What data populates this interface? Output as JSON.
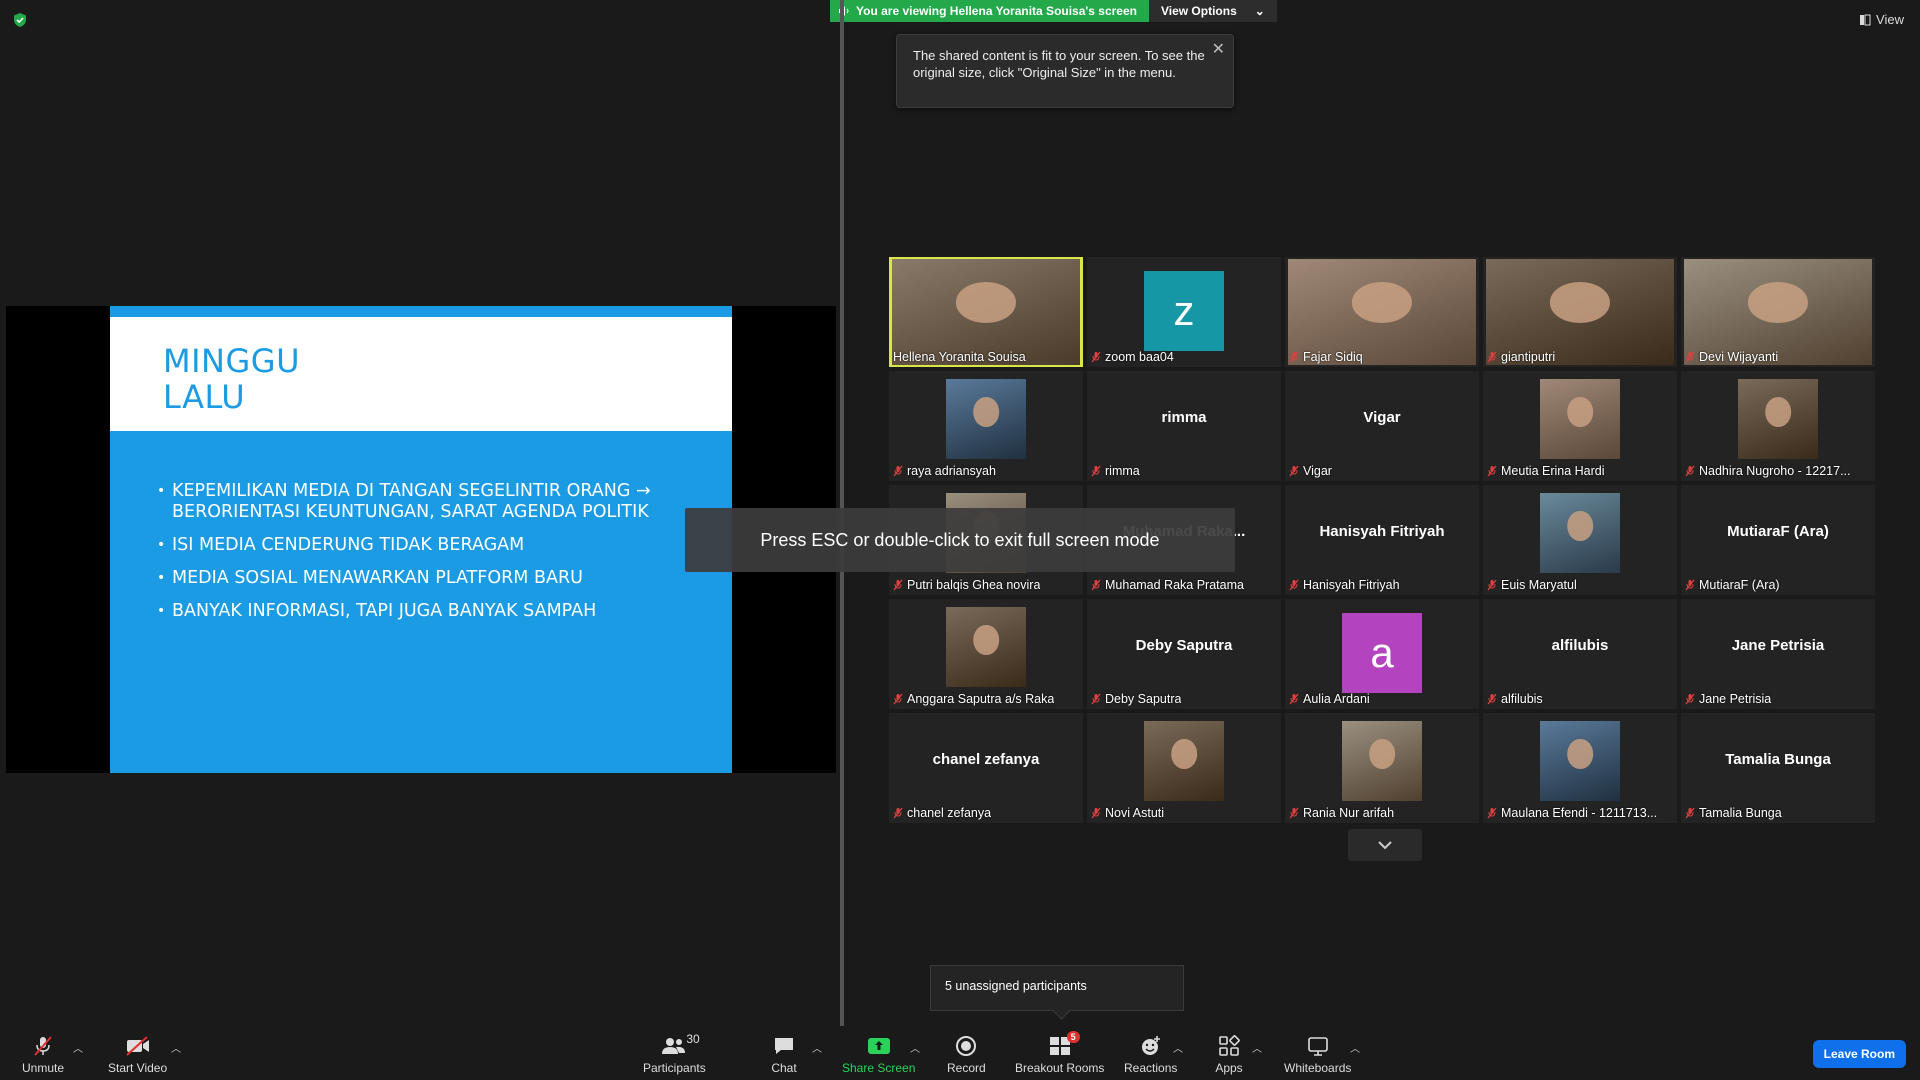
{
  "banner": {
    "viewing_text": "You are viewing Hellena Yoranita Souisa's screen",
    "view_options_label": "View Options"
  },
  "view_button_label": "View",
  "tooltip": {
    "text": "The shared content is fit to your screen. To see the original size, click \"Original Size\" in the menu."
  },
  "slide": {
    "title_line1": "MINGGU",
    "title_line2": "LALU",
    "bullets": [
      "KEPEMILIKAN MEDIA DI TANGAN SEGELINTIR ORANG → BERORIENTASI KEUNTUNGAN, SARAT AGENDA POLITIK",
      "ISI MEDIA CENDERUNG TIDAK BERAGAM",
      "MEDIA SOSIAL MENAWARKAN PLATFORM BARU",
      "BANYAK INFORMASI, TAPI JUGA BANYAK SAMPAH"
    ]
  },
  "esc_message": "Press ESC or double-click to exit full screen mode",
  "participants": [
    {
      "label": "Hellena Yoranita Souisa",
      "center": "",
      "muted": false,
      "kind": "video"
    },
    {
      "label": "zoom baa04",
      "center": "",
      "muted": true,
      "kind": "letter",
      "letter": "z",
      "color": "#1597a5"
    },
    {
      "label": "Fajar Sidiq",
      "center": "",
      "muted": true,
      "kind": "video"
    },
    {
      "label": "giantiputri",
      "center": "",
      "muted": true,
      "kind": "video"
    },
    {
      "label": "Devi Wijayanti",
      "center": "",
      "muted": true,
      "kind": "video"
    },
    {
      "label": "raya adriansyah",
      "center": "",
      "muted": true,
      "kind": "photo"
    },
    {
      "label": "rimma",
      "center": "rimma",
      "muted": true,
      "kind": "name"
    },
    {
      "label": "Vigar",
      "center": "Vigar",
      "muted": true,
      "kind": "name"
    },
    {
      "label": "Meutia Erina Hardi",
      "center": "",
      "muted": true,
      "kind": "photo"
    },
    {
      "label": "Nadhira Nugroho - 12217...",
      "center": "",
      "muted": true,
      "kind": "photo"
    },
    {
      "label": "Putri balqis Ghea novira",
      "center": "",
      "muted": true,
      "kind": "photo"
    },
    {
      "label": "Muhamad Raka Pratama",
      "center": "Muhamad Raka...",
      "muted": true,
      "kind": "name"
    },
    {
      "label": "Hanisyah Fitriyah",
      "center": "Hanisyah Fitriyah",
      "muted": true,
      "kind": "name"
    },
    {
      "label": "Euis Maryatul",
      "center": "",
      "muted": true,
      "kind": "photo"
    },
    {
      "label": "MutiaraF (Ara)",
      "center": "MutiaraF (Ara)",
      "muted": true,
      "kind": "name"
    },
    {
      "label": "Anggara Saputra a/s Raka",
      "center": "",
      "muted": true,
      "kind": "photo"
    },
    {
      "label": "Deby Saputra",
      "center": "Deby Saputra",
      "muted": true,
      "kind": "name"
    },
    {
      "label": "Aulia Ardani",
      "center": "",
      "muted": true,
      "kind": "letter",
      "letter": "a",
      "color": "#b443c0"
    },
    {
      "label": "alfilubis",
      "center": "alfilubis",
      "muted": true,
      "kind": "name"
    },
    {
      "label": "Jane Petrisia",
      "center": "Jane Petrisia",
      "muted": true,
      "kind": "name"
    },
    {
      "label": "chanel zefanya",
      "center": "chanel zefanya",
      "muted": true,
      "kind": "name"
    },
    {
      "label": "Novi Astuti",
      "center": "",
      "muted": true,
      "kind": "photo"
    },
    {
      "label": "Rania Nur arifah",
      "center": "",
      "muted": true,
      "kind": "photo"
    },
    {
      "label": "Maulana Efendi - 1211713...",
      "center": "",
      "muted": true,
      "kind": "photo"
    },
    {
      "label": "Tamalia Bunga",
      "center": "Tamalia Bunga",
      "muted": true,
      "kind": "name"
    }
  ],
  "unassigned_text": "5 unassigned participants",
  "toolbar": {
    "unmute": "Unmute",
    "start_video": "Start Video",
    "participants": "Participants",
    "participants_count": "30",
    "chat": "Chat",
    "share_screen": "Share Screen",
    "record": "Record",
    "breakout_rooms": "Breakout Rooms",
    "breakout_badge": "5",
    "reactions": "Reactions",
    "apps": "Apps",
    "whiteboards": "Whiteboards",
    "leave_room": "Leave Room"
  }
}
